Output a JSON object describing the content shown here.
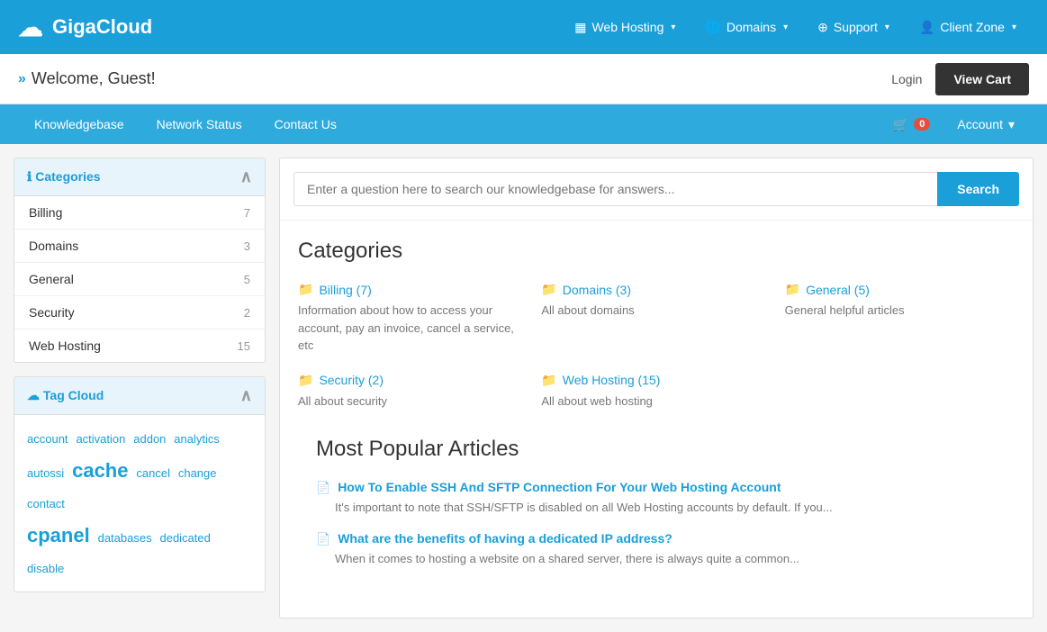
{
  "brand": {
    "name": "GigaCloud"
  },
  "topNav": {
    "links": [
      {
        "id": "web-hosting",
        "icon": "▦",
        "label": "Web Hosting",
        "hasDropdown": true
      },
      {
        "id": "domains",
        "icon": "🌐",
        "label": "Domains",
        "hasDropdown": true
      },
      {
        "id": "support",
        "icon": "⊕",
        "label": "Support",
        "hasDropdown": true
      },
      {
        "id": "client-zone",
        "icon": "👤",
        "label": "Client Zone",
        "hasDropdown": true
      }
    ]
  },
  "welcomeBar": {
    "arrows": "»",
    "text": "Welcome, Guest!",
    "loginLabel": "Login",
    "viewCartLabel": "View Cart"
  },
  "secondaryNav": {
    "links": [
      {
        "id": "knowledgebase",
        "label": "Knowledgebase"
      },
      {
        "id": "network-status",
        "label": "Network Status"
      },
      {
        "id": "contact-us",
        "label": "Contact Us"
      }
    ],
    "cartCount": "0",
    "accountLabel": "Account"
  },
  "sidebar": {
    "categoriesTitle": "Categories",
    "categories": [
      {
        "id": "billing",
        "label": "Billing",
        "count": "7"
      },
      {
        "id": "domains",
        "label": "Domains",
        "count": "3"
      },
      {
        "id": "general",
        "label": "General",
        "count": "5"
      },
      {
        "id": "security",
        "label": "Security",
        "count": "2"
      },
      {
        "id": "web-hosting",
        "label": "Web Hosting",
        "count": "15"
      }
    ],
    "tagCloudTitle": "Tag Cloud",
    "tags": [
      {
        "id": "account",
        "label": "account",
        "size": "small"
      },
      {
        "id": "activation",
        "label": "activation",
        "size": "small"
      },
      {
        "id": "addon",
        "label": "addon",
        "size": "small"
      },
      {
        "id": "analytics",
        "label": "analytics",
        "size": "small"
      },
      {
        "id": "autossi",
        "label": "autossi",
        "size": "small"
      },
      {
        "id": "cache",
        "label": "cache",
        "size": "large"
      },
      {
        "id": "cancel",
        "label": "cancel",
        "size": "small"
      },
      {
        "id": "change",
        "label": "change",
        "size": "small"
      },
      {
        "id": "contact",
        "label": "contact",
        "size": "small"
      },
      {
        "id": "cpanel",
        "label": "cpanel",
        "size": "large"
      },
      {
        "id": "databases",
        "label": "databases",
        "size": "small"
      },
      {
        "id": "dedicated",
        "label": "dedicated",
        "size": "small"
      },
      {
        "id": "disable",
        "label": "disable",
        "size": "small"
      }
    ]
  },
  "main": {
    "searchPlaceholder": "Enter a question here to search our knowledgebase for answers...",
    "searchLabel": "Search",
    "categoriesTitle": "Categories",
    "categories": [
      {
        "id": "billing",
        "label": "Billing (7)",
        "description": "Information about how to access your account, pay an invoice, cancel a service, etc"
      },
      {
        "id": "domains",
        "label": "Domains (3)",
        "description": "All about domains"
      },
      {
        "id": "general",
        "label": "General (5)",
        "description": "General helpful articles"
      },
      {
        "id": "security",
        "label": "Security (2)",
        "description": "All about security"
      },
      {
        "id": "web-hosting",
        "label": "Web Hosting (15)",
        "description": "All about web hosting"
      }
    ],
    "popularTitle": "Most Popular Articles",
    "articles": [
      {
        "id": "ssh-sftp",
        "title": "How To Enable SSH And SFTP Connection For Your Web Hosting Account",
        "description": "It's important to note that SSH/SFTP is disabled on all Web Hosting accounts by default. If you..."
      },
      {
        "id": "dedicated-ip",
        "title": "What are the benefits of having a dedicated IP address?",
        "description": "When it comes to hosting a website on a shared server, there is always quite a common..."
      }
    ]
  }
}
